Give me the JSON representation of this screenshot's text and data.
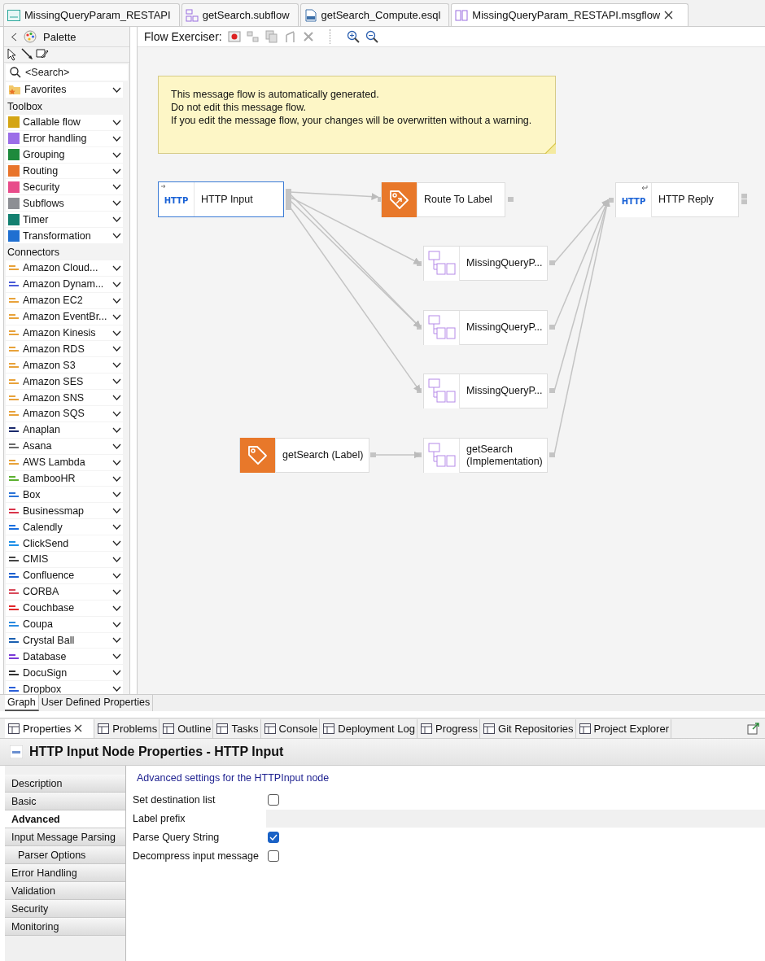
{
  "editor_tabs": [
    {
      "label": "MissingQueryParam_RESTAPI",
      "kind": "api",
      "selected": false
    },
    {
      "label": "getSearch.subflow",
      "kind": "subflow",
      "selected": false
    },
    {
      "label": "getSearch_Compute.esql",
      "kind": "esql",
      "selected": false
    },
    {
      "label": "MissingQueryParam_RESTAPI.msgflow",
      "kind": "msgflow",
      "selected": true
    }
  ],
  "palette": {
    "title": "Palette",
    "search_placeholder": "<Search>",
    "favorites": "Favorites",
    "sections": [
      {
        "title": "Toolbox",
        "items": [
          {
            "label": "Callable flow",
            "color": "#d4a514"
          },
          {
            "label": "Error handling",
            "color": "#9b6ee8"
          },
          {
            "label": "Grouping",
            "color": "#1e8a3c"
          },
          {
            "label": "Routing",
            "color": "#e8742a"
          },
          {
            "label": "Security",
            "color": "#e84c8a"
          },
          {
            "label": "Subflows",
            "color": "#8d8f94"
          },
          {
            "label": "Timer",
            "color": "#138070"
          },
          {
            "label": "Transformation",
            "color": "#1f6fd1"
          }
        ]
      },
      {
        "title": "Connectors",
        "items": [
          {
            "label": "Amazon Cloud...",
            "color": "#e8a23a"
          },
          {
            "label": "Amazon Dynam...",
            "color": "#4a5bd8"
          },
          {
            "label": "Amazon EC2",
            "color": "#e8a23a"
          },
          {
            "label": "Amazon EventBr...",
            "color": "#e8a23a"
          },
          {
            "label": "Amazon Kinesis",
            "color": "#e8a23a"
          },
          {
            "label": "Amazon RDS",
            "color": "#e8a23a"
          },
          {
            "label": "Amazon S3",
            "color": "#e8a23a"
          },
          {
            "label": "Amazon SES",
            "color": "#e8a23a"
          },
          {
            "label": "Amazon SNS",
            "color": "#e8a23a"
          },
          {
            "label": "Amazon SQS",
            "color": "#e8a23a"
          },
          {
            "label": "Anaplan",
            "color": "#1a2a6c"
          },
          {
            "label": "Asana",
            "color": "#6a6a6a"
          },
          {
            "label": "AWS Lambda",
            "color": "#e8a23a"
          },
          {
            "label": "BambooHR",
            "color": "#5cb030"
          },
          {
            "label": "Box",
            "color": "#2a74d8"
          },
          {
            "label": "Businessmap",
            "color": "#d8344a"
          },
          {
            "label": "Calendly",
            "color": "#1a6fe0"
          },
          {
            "label": "ClickSend",
            "color": "#1e90e8"
          },
          {
            "label": "CMIS",
            "color": "#444444"
          },
          {
            "label": "Confluence",
            "color": "#1a5fd0"
          },
          {
            "label": "CORBA",
            "color": "#d84a5a"
          },
          {
            "label": "Couchbase",
            "color": "#e2262a"
          },
          {
            "label": "Coupa",
            "color": "#2a8ae0"
          },
          {
            "label": "Crystal Ball",
            "color": "#1a5fb0"
          },
          {
            "label": "Database",
            "color": "#7a3ad8"
          },
          {
            "label": "DocuSign",
            "color": "#333333"
          },
          {
            "label": "Dropbox",
            "color": "#2a5fd8"
          }
        ]
      }
    ]
  },
  "toolbar": {
    "label": "Flow Exerciser:"
  },
  "note": {
    "lines": [
      "This message flow is automatically generated.",
      "Do not edit this message flow.",
      "If you edit the message flow, your changes will be overwritten without a warning."
    ]
  },
  "nodes": [
    {
      "label": "HTTP Input",
      "kind": "http_input",
      "selected": true,
      "icon_text": "HTTP"
    },
    {
      "label": "Route To Label",
      "kind": "route",
      "selected": false
    },
    {
      "label": "HTTP Reply",
      "kind": "http_reply",
      "selected": false,
      "icon_text": "HTTP"
    },
    {
      "label": "MissingQueryP...",
      "kind": "subflow",
      "selected": false
    },
    {
      "label": "MissingQueryP...",
      "kind": "subflow",
      "selected": false
    },
    {
      "label": "MissingQueryP...",
      "kind": "subflow",
      "selected": false
    },
    {
      "label": "getSearch (Label)",
      "kind": "label",
      "selected": false
    },
    {
      "label": "getSearch (Implementation)",
      "kind": "subflow",
      "selected": false
    }
  ],
  "view_tabs": [
    {
      "label": "Graph",
      "selected": true
    },
    {
      "label": "User Defined Properties",
      "selected": false
    }
  ],
  "bottom_tabs": [
    {
      "label": "Properties",
      "selected": true
    },
    {
      "label": "Problems",
      "selected": false
    },
    {
      "label": "Outline",
      "selected": false
    },
    {
      "label": "Tasks",
      "selected": false
    },
    {
      "label": "Console",
      "selected": false
    },
    {
      "label": "Deployment Log",
      "selected": false
    },
    {
      "label": "Progress",
      "selected": false
    },
    {
      "label": "Git Repositories",
      "selected": false
    },
    {
      "label": "Project Explorer",
      "selected": false
    }
  ],
  "properties": {
    "title": "HTTP Input Node Properties - HTTP Input",
    "sections": [
      {
        "label": "Description",
        "selected": false
      },
      {
        "label": "Basic",
        "selected": false
      },
      {
        "label": "Advanced",
        "selected": true
      },
      {
        "label": "Input Message Parsing",
        "selected": false,
        "children": [
          {
            "label": "Parser Options",
            "selected": false
          }
        ]
      },
      {
        "label": "Error Handling",
        "selected": false
      },
      {
        "label": "Validation",
        "selected": false
      },
      {
        "label": "Security",
        "selected": false
      },
      {
        "label": "Monitoring",
        "selected": false
      }
    ],
    "heading": "Advanced settings for the HTTPInput node",
    "fields": [
      {
        "label": "Set destination list",
        "kind": "checkbox",
        "checked": false
      },
      {
        "label": "Label prefix",
        "kind": "text"
      },
      {
        "label": "Parse Query String",
        "kind": "checkbox",
        "checked": true
      },
      {
        "label": "Decompress input message",
        "kind": "checkbox",
        "checked": false
      }
    ]
  }
}
